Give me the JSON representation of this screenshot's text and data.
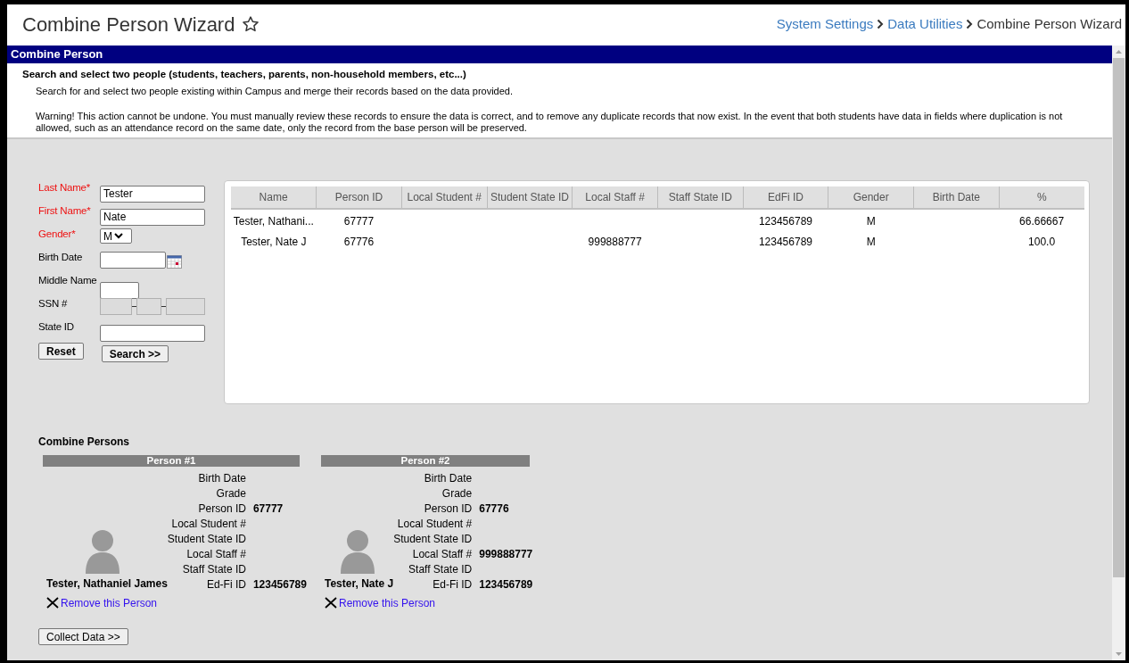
{
  "page": {
    "title": "Combine Person Wizard",
    "favorite": false
  },
  "breadcrumb": [
    {
      "label": "System Settings",
      "kind": "link"
    },
    {
      "label": "Data Utilities",
      "kind": "link"
    },
    {
      "label": "Combine Person Wizard",
      "kind": "current"
    }
  ],
  "section": {
    "title": "Combine Person",
    "heading": "Search and select two people (students, teachers, parents, non-household members, etc...)",
    "intro": "Search for and select two people existing within Campus and merge their records based on the data provided.",
    "warning": "Warning! This action cannot be undone. You must manually review these records to ensure the data is correct, and to remove any duplicate records that now exist. In the event that both students have data in fields where duplication is not allowed, such as an attendance record on the same date, only the record from the base person will be preserved."
  },
  "search_form": {
    "fields": [
      {
        "label": "Last Name*",
        "required": true,
        "kind": "text",
        "value": "Tester"
      },
      {
        "label": "First Name*",
        "required": true,
        "kind": "text",
        "value": "Nate"
      },
      {
        "label": "Gender*",
        "required": true,
        "kind": "select",
        "value": "M"
      },
      {
        "label": "Birth Date",
        "required": false,
        "kind": "date"
      },
      {
        "label": "Middle Name",
        "required": false,
        "kind": "short"
      },
      {
        "label": "SSN #",
        "required": false,
        "kind": "ssn",
        "disabled": true
      },
      {
        "label": "State ID",
        "required": false,
        "kind": "text"
      }
    ],
    "buttons": [
      "Reset",
      "Search >>"
    ]
  },
  "results": {
    "columns": [
      "Name",
      "Person ID",
      "Local Student #",
      "Student State ID",
      "Local Staff #",
      "Staff State ID",
      "EdFi ID",
      "Gender",
      "Birth Date",
      "%"
    ],
    "rows": [
      [
        "Tester, Nathani...",
        "67777",
        null,
        null,
        null,
        null,
        "123456789",
        "M",
        null,
        "66.66667"
      ],
      [
        "Tester, Nate J",
        "67776",
        null,
        null,
        "999888777",
        null,
        "123456789",
        "M",
        null,
        "100.0"
      ]
    ]
  },
  "combine": {
    "title": "Combine Persons",
    "persons": [
      {
        "header": "Person #1",
        "name": "Tester, Nathaniel James",
        "remove": "Remove this Person",
        "fields": [
          {
            "label": "Birth Date"
          },
          {
            "label": "Grade"
          },
          {
            "label": "Person ID",
            "value": "67777"
          },
          {
            "label": "Local Student #"
          },
          {
            "label": "Student State ID"
          },
          {
            "label": "Local Staff #"
          },
          {
            "label": "Staff State ID"
          },
          {
            "label": "Ed-Fi ID",
            "value": "123456789"
          }
        ]
      },
      {
        "header": "Person #2",
        "name": "Tester, Nate J",
        "remove": "Remove this Person",
        "fields": [
          {
            "label": "Birth Date"
          },
          {
            "label": "Grade"
          },
          {
            "label": "Person ID",
            "value": "67776"
          },
          {
            "label": "Local Student #"
          },
          {
            "label": "Student State ID"
          },
          {
            "label": "Local Staff #",
            "value": "999888777"
          },
          {
            "label": "Staff State ID"
          },
          {
            "label": "Ed-Fi ID",
            "value": "123456789"
          }
        ]
      }
    ],
    "button": "Collect Data >>"
  }
}
